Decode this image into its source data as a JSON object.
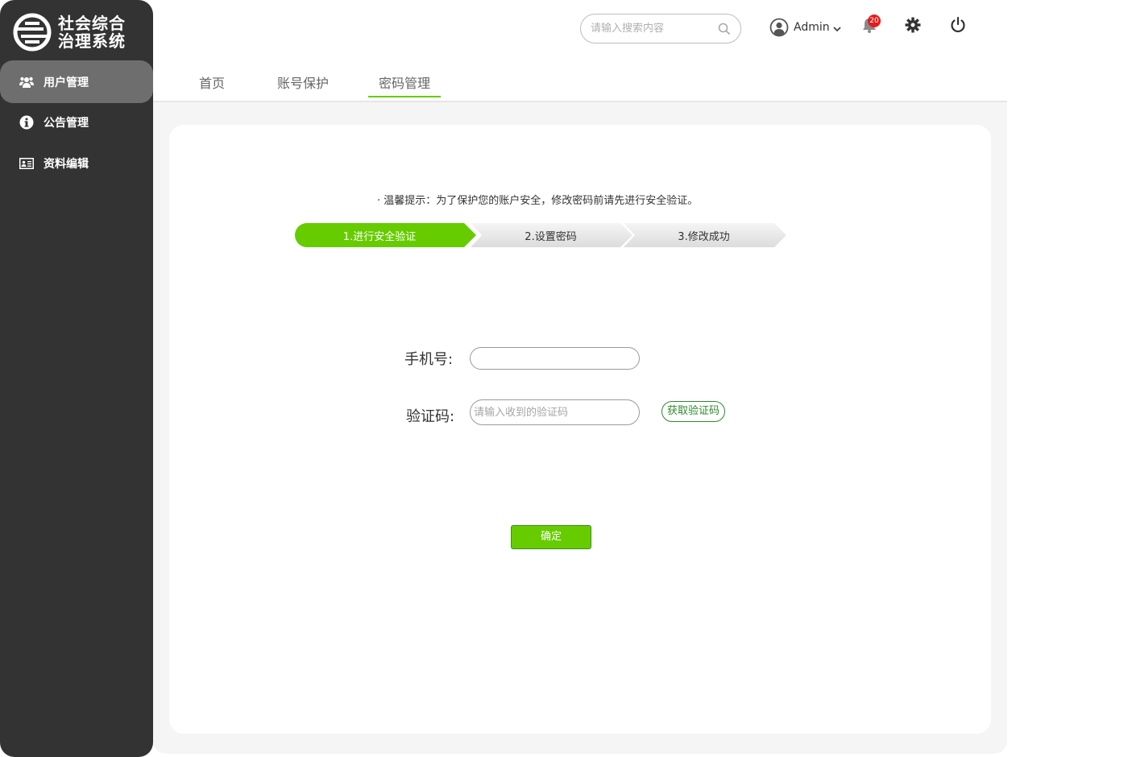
{
  "app": {
    "logo_line1": "社会综合",
    "logo_line2": "治理系统"
  },
  "sidebar": {
    "items": [
      {
        "label": "用户管理",
        "icon": "users-icon",
        "active": true
      },
      {
        "label": "公告管理",
        "icon": "info-icon",
        "active": false
      },
      {
        "label": "资料编辑",
        "icon": "id-card-icon",
        "active": false
      }
    ]
  },
  "header": {
    "search_placeholder": "请输入搜索内容",
    "user_name": "Admin",
    "notification_count": "20"
  },
  "tabs": [
    {
      "label": "首页",
      "active": false
    },
    {
      "label": "账号保护",
      "active": false
    },
    {
      "label": "密码管理",
      "active": true
    }
  ],
  "form": {
    "tip": "· 温馨提示：为了保护您的账户安全，修改密码前请先进行安全验证。",
    "steps": [
      "1.进行安全验证",
      "2.设置密码",
      "3.修改成功"
    ],
    "active_step": 1,
    "phone_label": "手机号:",
    "phone_value": "",
    "code_label": "验证码:",
    "code_placeholder": "请输入收到的验证码",
    "get_code_label": "获取验证码",
    "confirm_label": "确定"
  },
  "colors": {
    "sidebar_bg": "#333333",
    "sidebar_active": "#6e6e6e",
    "accent_green": "#66cc00",
    "badge_red": "#e51c1c"
  }
}
